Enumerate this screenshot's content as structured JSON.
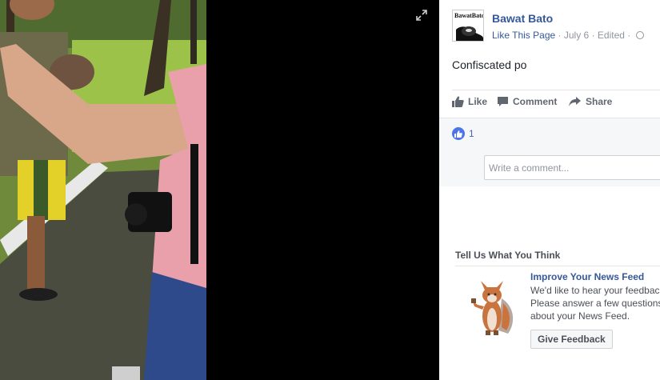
{
  "post": {
    "page_name": "Bawat Bato",
    "avatar_text": "BawatBato",
    "like_page_label": "Like This Page",
    "separator": "·",
    "date": "July 6",
    "edited": "Edited",
    "text": "Confiscated po"
  },
  "actions": {
    "like": "Like",
    "comment": "Comment",
    "share": "Share"
  },
  "reactions": {
    "count": "1"
  },
  "comment": {
    "placeholder": "Write a comment..."
  },
  "ad": {
    "section_title": "Tell Us What You Think",
    "headline": "Improve Your News Feed",
    "description": "We'd like to hear your feedback. Please answer a few questions about your News Feed.",
    "button": "Give Feedback"
  },
  "colors": {
    "link": "#365899",
    "like_blue": "#4a76e8",
    "muted": "#90949c"
  },
  "icons": [
    "expand-icon",
    "globe-icon",
    "thumbs-up-icon",
    "comment-icon",
    "share-icon",
    "fox-illustration"
  ]
}
